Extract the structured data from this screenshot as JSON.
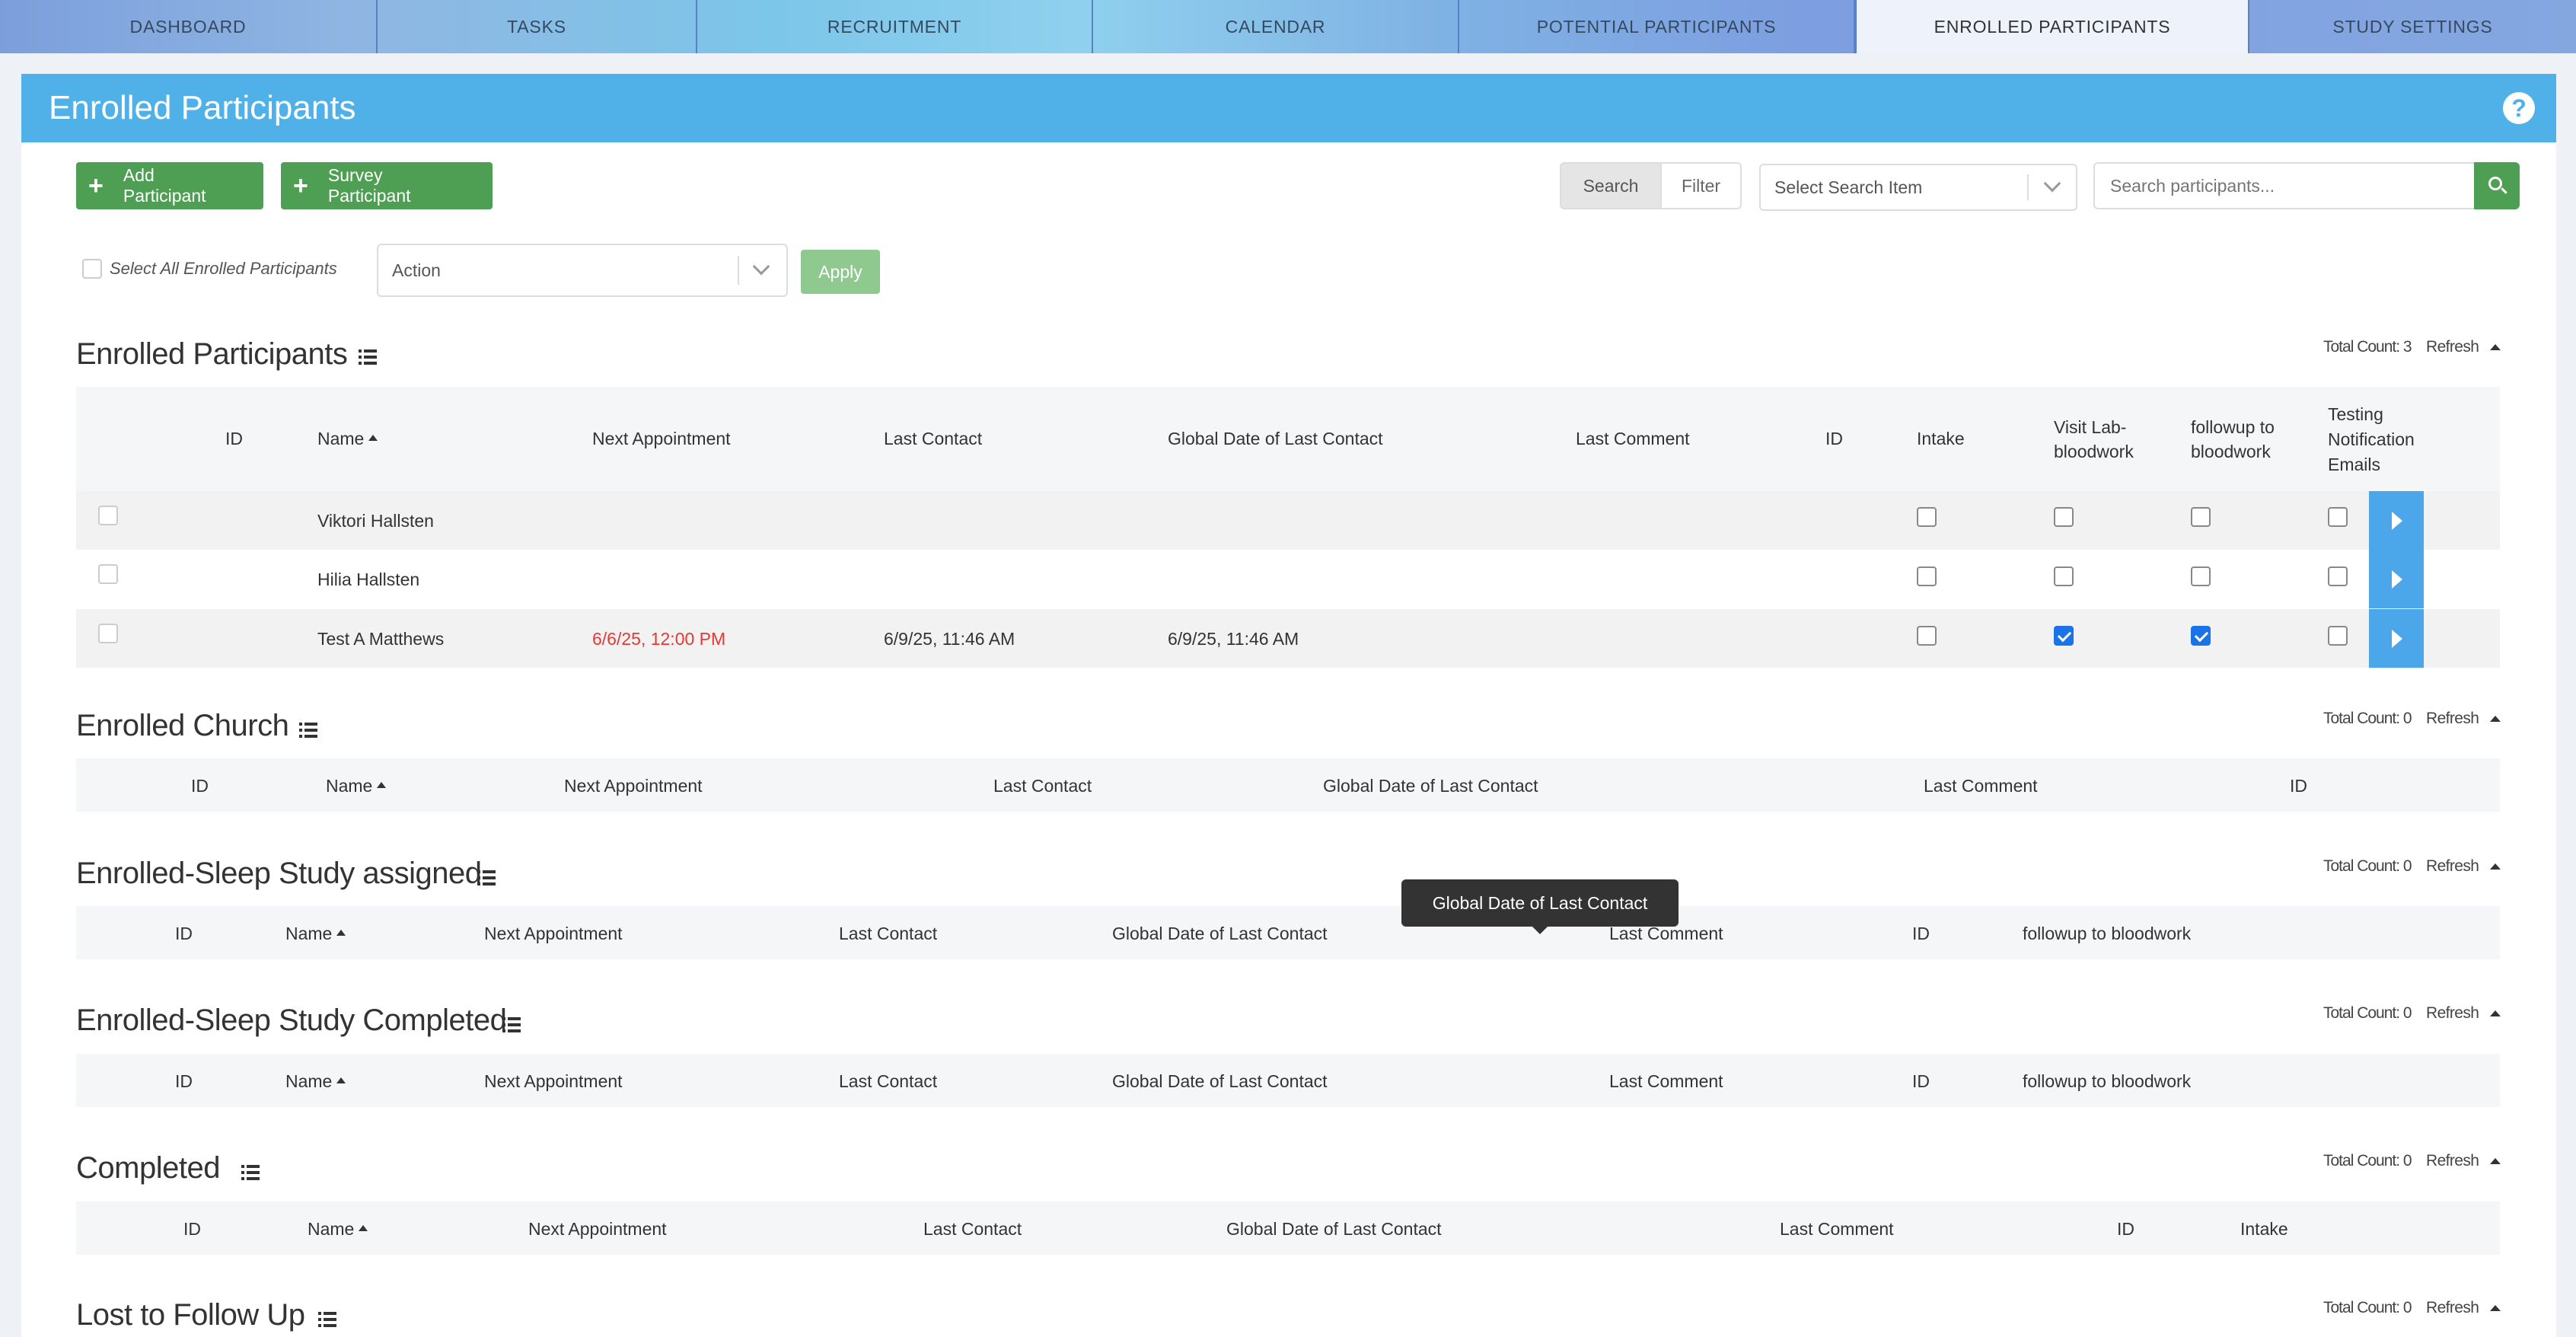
{
  "nav": {
    "tabs": [
      {
        "label": "DASHBOARD"
      },
      {
        "label": "TASKS"
      },
      {
        "label": "RECRUITMENT"
      },
      {
        "label": "CALENDAR"
      },
      {
        "label": "POTENTIAL PARTICIPANTS"
      },
      {
        "label": "ENROLLED PARTICIPANTS"
      },
      {
        "label": "STUDY SETTINGS"
      }
    ],
    "active_tab": "ENROLLED PARTICIPANTS"
  },
  "header": {
    "title": "Enrolled Participants",
    "help_icon": "question-circle-icon"
  },
  "toolbar": {
    "add_participant_label": "Add Participant",
    "survey_participant_label": "Survey Participant",
    "search_toggle": "Search",
    "filter_toggle": "Filter",
    "search_item_value": "Select Search Item",
    "search_placeholder": "Search participants...",
    "select_all_label": "Select All Enrolled Participants",
    "action_value": "Action",
    "apply_label": "Apply"
  },
  "colors": {
    "header": "#50b1e9",
    "green": "#4e9f53",
    "arrow_button": "#4ba6ea",
    "appointment_red": "#e53935",
    "checkbox_checked": "#1a73e8"
  },
  "sections": [
    {
      "title": "Enrolled Participants",
      "total": "Total Count: 3",
      "refresh": "Refresh",
      "columns": [
        "ID",
        "Name",
        "Next Appointment",
        "Last Contact",
        "Global Date of Last Contact",
        "Last Comment",
        "ID",
        "Intake",
        "Visit Lab-bloodwork",
        "followup to bloodwork",
        "Testing Notification Emails"
      ],
      "rows": [
        {
          "name": "Viktori Hallsten",
          "next_appointment": "",
          "last_contact": "",
          "global_last_contact": "",
          "intake": false,
          "visit_lab": false,
          "followup": false,
          "testing": false
        },
        {
          "name": "Hilia Hallsten",
          "next_appointment": "",
          "last_contact": "",
          "global_last_contact": "",
          "intake": false,
          "visit_lab": false,
          "followup": false,
          "testing": false
        },
        {
          "name": "Test A Matthews",
          "next_appointment": "6/6/25, 12:00 PM",
          "last_contact": "6/9/25, 11:46 AM",
          "global_last_contact": "6/9/25, 11:46 AM",
          "intake": false,
          "visit_lab": true,
          "followup": true,
          "testing": false
        }
      ]
    },
    {
      "title": "Enrolled Church",
      "total": "Total Count: 0",
      "refresh": "Refresh",
      "columns": [
        "ID",
        "Name",
        "Next Appointment",
        "Last Contact",
        "Global Date of Last Contact",
        "Last Comment",
        "ID"
      ]
    },
    {
      "title": "Enrolled-Sleep Study assigned",
      "total": "Total Count: 0",
      "refresh": "Refresh",
      "columns": [
        "ID",
        "Name",
        "Next Appointment",
        "Last Contact",
        "Global Date of Last Contact",
        "Last Comment",
        "ID",
        "followup to bloodwork"
      ]
    },
    {
      "title": "Enrolled-Sleep Study Completed",
      "total": "Total Count: 0",
      "refresh": "Refresh",
      "columns": [
        "ID",
        "Name",
        "Next Appointment",
        "Last Contact",
        "Global Date of Last Contact",
        "Last Comment",
        "ID",
        "followup to bloodwork"
      ]
    },
    {
      "title": "Completed",
      "total": "Total Count: 0",
      "refresh": "Refresh",
      "columns": [
        "ID",
        "Name",
        "Next Appointment",
        "Last Contact",
        "Global Date of Last Contact",
        "Last Comment",
        "ID",
        "Intake"
      ]
    },
    {
      "title": "Lost to Follow Up",
      "total": "Total Count: 0",
      "refresh": "Refresh"
    }
  ],
  "tooltip": {
    "text": "Global Date of Last Contact"
  }
}
